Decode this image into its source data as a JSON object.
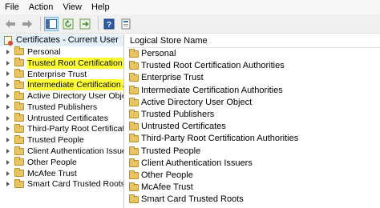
{
  "menu": [
    "File",
    "Action",
    "View",
    "Help"
  ],
  "tree": {
    "root_label": "Certificates - Current User",
    "items": [
      {
        "label": "Personal",
        "highlighted": false
      },
      {
        "label": "Trusted Root Certification Au",
        "highlighted": true
      },
      {
        "label": "Enterprise Trust",
        "highlighted": false
      },
      {
        "label": "Intermediate Certification Au",
        "highlighted": true
      },
      {
        "label": "Active Directory User Object",
        "highlighted": false
      },
      {
        "label": "Trusted Publishers",
        "highlighted": false
      },
      {
        "label": "Untrusted Certificates",
        "highlighted": false
      },
      {
        "label": "Third-Party Root Certification",
        "highlighted": false
      },
      {
        "label": "Trusted People",
        "highlighted": false
      },
      {
        "label": "Client Authentication Issuers",
        "highlighted": false
      },
      {
        "label": "Other People",
        "highlighted": false
      },
      {
        "label": "McAfee Trust",
        "highlighted": false
      },
      {
        "label": "Smart Card Trusted Roots",
        "highlighted": false
      }
    ]
  },
  "list": {
    "column_header": "Logical Store Name",
    "items": [
      "Personal",
      "Trusted Root Certification Authorities",
      "Enterprise Trust",
      "Intermediate Certification Authorities",
      "Active Directory User Object",
      "Trusted Publishers",
      "Untrusted Certificates",
      "Third-Party Root Certification Authorities",
      "Trusted People",
      "Client Authentication Issuers",
      "Other People",
      "McAfee Trust",
      "Smart Card Trusted Roots"
    ]
  },
  "colors": {
    "highlight": "#ffff33",
    "folder": "#e8c463"
  }
}
